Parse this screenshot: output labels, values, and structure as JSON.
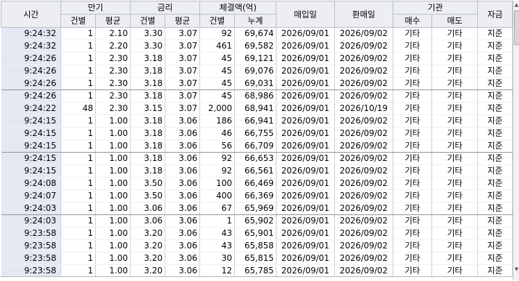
{
  "headers": {
    "time": "시간",
    "maturity": "만기",
    "rate": "금리",
    "amount": "체결액(억)",
    "buy_date": "매입일",
    "resell_date": "환매일",
    "institution": "기관",
    "fund": "자금",
    "count": "건별",
    "avg": "평균",
    "total": "누계",
    "buy": "매수",
    "sell": "매도"
  },
  "rows": [
    {
      "time": "9:24:32",
      "m_cnt": "1",
      "m_avg": "2.10",
      "r_cnt": "3.30",
      "r_avg": "3.07",
      "a_cnt": "92",
      "a_total": "69,674",
      "buy_date": "2026/09/01",
      "resell_date": "2026/09/02",
      "buy": "기타",
      "sell": "기타",
      "fund": "지준"
    },
    {
      "time": "9:24:32",
      "m_cnt": "1",
      "m_avg": "2.20",
      "r_cnt": "3.30",
      "r_avg": "3.07",
      "a_cnt": "461",
      "a_total": "69,582",
      "buy_date": "2026/09/01",
      "resell_date": "2026/09/02",
      "buy": "기타",
      "sell": "기타",
      "fund": "지준"
    },
    {
      "time": "9:24:26",
      "m_cnt": "1",
      "m_avg": "2.30",
      "r_cnt": "3.18",
      "r_avg": "3.07",
      "a_cnt": "45",
      "a_total": "69,121",
      "buy_date": "2026/09/01",
      "resell_date": "2026/09/02",
      "buy": "기타",
      "sell": "기타",
      "fund": "지준"
    },
    {
      "time": "9:24:26",
      "m_cnt": "1",
      "m_avg": "2.30",
      "r_cnt": "3.18",
      "r_avg": "3.07",
      "a_cnt": "45",
      "a_total": "69,076",
      "buy_date": "2026/09/01",
      "resell_date": "2026/09/02",
      "buy": "기타",
      "sell": "기타",
      "fund": "지준"
    },
    {
      "time": "9:24:26",
      "m_cnt": "1",
      "m_avg": "2.30",
      "r_cnt": "3.18",
      "r_avg": "3.07",
      "a_cnt": "45",
      "a_total": "69,031",
      "buy_date": "2026/09/01",
      "resell_date": "2026/09/02",
      "buy": "기타",
      "sell": "기타",
      "fund": "지준"
    },
    {
      "time": "9:24:26",
      "m_cnt": "1",
      "m_avg": "2.30",
      "r_cnt": "3.18",
      "r_avg": "3.07",
      "a_cnt": "45",
      "a_total": "68,986",
      "buy_date": "2026/09/01",
      "resell_date": "2026/09/02",
      "buy": "기타",
      "sell": "기타",
      "fund": "지준"
    },
    {
      "time": "9:24:22",
      "m_cnt": "48",
      "m_avg": "2.30",
      "r_cnt": "3.15",
      "r_avg": "3.07",
      "a_cnt": "2,000",
      "a_total": "68,941",
      "buy_date": "2026/09/01",
      "resell_date": "2026/10/19",
      "buy": "기타",
      "sell": "기타",
      "fund": "지준"
    },
    {
      "time": "9:24:15",
      "m_cnt": "1",
      "m_avg": "1.00",
      "r_cnt": "3.18",
      "r_avg": "3.06",
      "a_cnt": "186",
      "a_total": "66,941",
      "buy_date": "2026/09/01",
      "resell_date": "2026/09/02",
      "buy": "기타",
      "sell": "기타",
      "fund": "지준"
    },
    {
      "time": "9:24:15",
      "m_cnt": "1",
      "m_avg": "1.00",
      "r_cnt": "3.18",
      "r_avg": "3.06",
      "a_cnt": "46",
      "a_total": "66,755",
      "buy_date": "2026/09/01",
      "resell_date": "2026/09/02",
      "buy": "기타",
      "sell": "기타",
      "fund": "지준"
    },
    {
      "time": "9:24:15",
      "m_cnt": "1",
      "m_avg": "1.00",
      "r_cnt": "3.18",
      "r_avg": "3.06",
      "a_cnt": "56",
      "a_total": "66,709",
      "buy_date": "2026/09/01",
      "resell_date": "2026/09/02",
      "buy": "기타",
      "sell": "기타",
      "fund": "지준"
    },
    {
      "time": "9:24:15",
      "m_cnt": "1",
      "m_avg": "1.00",
      "r_cnt": "3.18",
      "r_avg": "3.06",
      "a_cnt": "92",
      "a_total": "66,653",
      "buy_date": "2026/09/01",
      "resell_date": "2026/09/02",
      "buy": "기타",
      "sell": "기타",
      "fund": "지준"
    },
    {
      "time": "9:24:15",
      "m_cnt": "1",
      "m_avg": "1.00",
      "r_cnt": "3.18",
      "r_avg": "3.06",
      "a_cnt": "92",
      "a_total": "66,561",
      "buy_date": "2026/09/01",
      "resell_date": "2026/09/02",
      "buy": "기타",
      "sell": "기타",
      "fund": "지준"
    },
    {
      "time": "9:24:08",
      "m_cnt": "1",
      "m_avg": "1.00",
      "r_cnt": "3.50",
      "r_avg": "3.06",
      "a_cnt": "100",
      "a_total": "66,469",
      "buy_date": "2026/09/01",
      "resell_date": "2026/09/02",
      "buy": "기타",
      "sell": "기타",
      "fund": "지준"
    },
    {
      "time": "9:24:07",
      "m_cnt": "1",
      "m_avg": "1.00",
      "r_cnt": "3.50",
      "r_avg": "3.06",
      "a_cnt": "400",
      "a_total": "66,369",
      "buy_date": "2026/09/01",
      "resell_date": "2026/09/02",
      "buy": "기타",
      "sell": "기타",
      "fund": "지준"
    },
    {
      "time": "9:24:03",
      "m_cnt": "1",
      "m_avg": "1.00",
      "r_cnt": "3.06",
      "r_avg": "3.06",
      "a_cnt": "67",
      "a_total": "65,969",
      "buy_date": "2026/09/01",
      "resell_date": "2026/09/02",
      "buy": "기타",
      "sell": "기타",
      "fund": "지준"
    },
    {
      "time": "9:24:03",
      "m_cnt": "1",
      "m_avg": "1.00",
      "r_cnt": "3.06",
      "r_avg": "3.06",
      "a_cnt": "1",
      "a_total": "65,902",
      "buy_date": "2026/09/01",
      "resell_date": "2026/09/02",
      "buy": "기타",
      "sell": "기타",
      "fund": "지준"
    },
    {
      "time": "9:23:58",
      "m_cnt": "1",
      "m_avg": "1.00",
      "r_cnt": "3.20",
      "r_avg": "3.06",
      "a_cnt": "43",
      "a_total": "65,901",
      "buy_date": "2026/09/01",
      "resell_date": "2026/09/02",
      "buy": "기타",
      "sell": "기타",
      "fund": "지준"
    },
    {
      "time": "9:23:58",
      "m_cnt": "1",
      "m_avg": "1.00",
      "r_cnt": "3.20",
      "r_avg": "3.06",
      "a_cnt": "43",
      "a_total": "65,858",
      "buy_date": "2026/09/01",
      "resell_date": "2026/09/02",
      "buy": "기타",
      "sell": "기타",
      "fund": "지준"
    },
    {
      "time": "9:23:58",
      "m_cnt": "1",
      "m_avg": "1.00",
      "r_cnt": "3.20",
      "r_avg": "3.06",
      "a_cnt": "30",
      "a_total": "65,815",
      "buy_date": "2026/09/01",
      "resell_date": "2026/09/02",
      "buy": "기타",
      "sell": "기타",
      "fund": "지준"
    },
    {
      "time": "9:23:58",
      "m_cnt": "1",
      "m_avg": "1.00",
      "r_cnt": "3.20",
      "r_avg": "3.06",
      "a_cnt": "12",
      "a_total": "65,785",
      "buy_date": "2026/09/01",
      "resell_date": "2026/09/02",
      "buy": "기타",
      "sell": "기타",
      "fund": "지준"
    }
  ]
}
